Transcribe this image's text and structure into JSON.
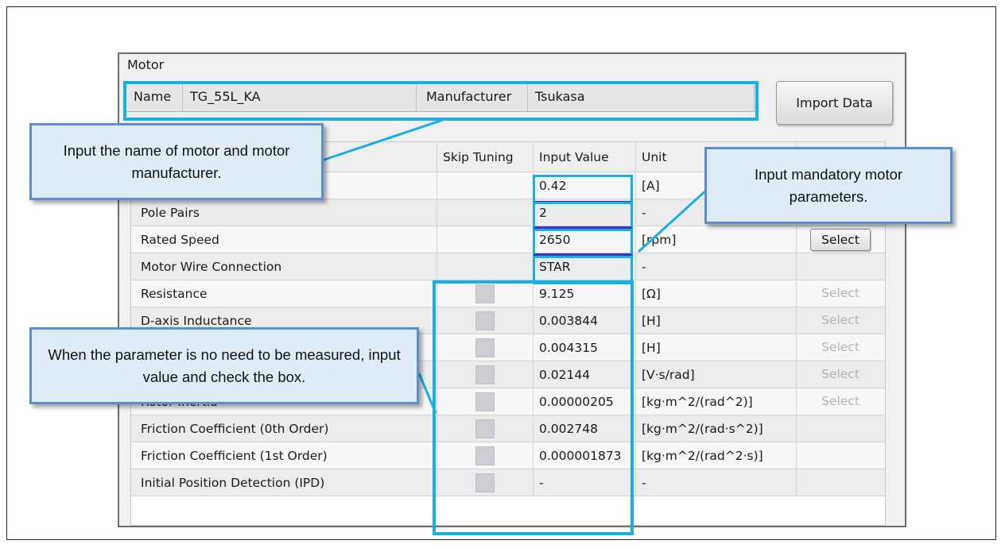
{
  "panel": {
    "title": "Motor",
    "import_label": "Import Data"
  },
  "name_row": {
    "name_label": "Name",
    "name_value": "TG_55L_KA",
    "manufacturer_label": "Manufacturer",
    "manufacturer_value": "Tsukasa"
  },
  "table": {
    "headers": [
      "Skip Tuning",
      "Input Value",
      "Unit"
    ],
    "rows": [
      {
        "label": "",
        "value": "0.42",
        "unit": "[A]",
        "skip": false,
        "select": ""
      },
      {
        "label": "Pole Pairs",
        "value": "2",
        "unit": "-",
        "skip": false,
        "select": ""
      },
      {
        "label": "Rated Speed",
        "value": "2650",
        "unit": "[rpm]",
        "skip": false,
        "select": "Select"
      },
      {
        "label": "Motor Wire Connection",
        "value": "STAR",
        "unit": "-",
        "skip": false,
        "select": ""
      },
      {
        "label": "Resistance",
        "value": "9.125",
        "unit": "[Ω]",
        "skip": true,
        "select": "Select"
      },
      {
        "label": "D-axis Inductance",
        "value": "0.003844",
        "unit": "[H]",
        "skip": true,
        "select": "Select"
      },
      {
        "label": "",
        "value": "0.004315",
        "unit": "[H]",
        "skip": true,
        "select": "Select"
      },
      {
        "label": "",
        "value": "0.02144",
        "unit": "[V·s/rad]",
        "skip": true,
        "select": "Select"
      },
      {
        "label": "Rotor Inertia",
        "value": "0.00000205",
        "unit": "[kg·m^2/(rad^2)]",
        "skip": true,
        "select": "Select"
      },
      {
        "label": "Friction Coefficient (0th Order)",
        "value": "0.002748",
        "unit": "[kg·m^2/(rad·s^2)]",
        "skip": true,
        "select": ""
      },
      {
        "label": "Friction Coefficient (1st Order)",
        "value": "0.000001873",
        "unit": "[kg·m^2/(rad^2·s)]",
        "skip": true,
        "select": ""
      },
      {
        "label": "Initial Position Detection (IPD)",
        "value": "-",
        "unit": "-",
        "skip": true,
        "select": ""
      }
    ]
  },
  "callouts": {
    "name": "Input the name of motor and motor manufacturer.",
    "mandatory": "Input mandatory motor parameters.",
    "skip": "When the parameter is no need to be measured, input value and check the box."
  },
  "colors": {
    "highlight": "#17b0e6",
    "callout_fill": "#dfecf7",
    "callout_border": "#5b8fd1"
  }
}
